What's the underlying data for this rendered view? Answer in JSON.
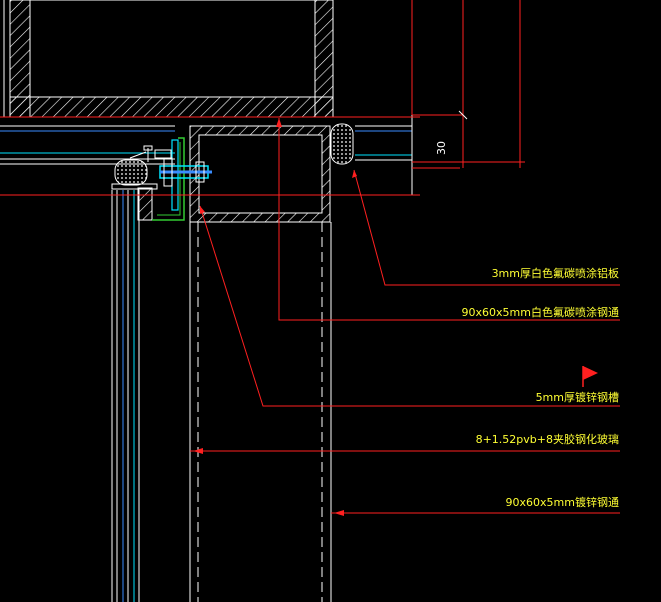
{
  "drawing": {
    "background": "#000000",
    "colors": {
      "structure": "#ffffff",
      "hatch": "#ffffff",
      "leader": "#ff2020",
      "label": "#ffff33",
      "glass": "#3a8dff",
      "cyan": "#00e5ff",
      "green": "#33cc33",
      "flag": "#ff2020"
    },
    "dimension": {
      "value": "30"
    },
    "callouts": [
      {
        "id": "aluminum-panel",
        "text": "3mm厚白色氟碳喷涂铝板"
      },
      {
        "id": "steel-tube-white",
        "text": "90x60x5mm白色氟碳喷涂钢通"
      },
      {
        "id": "steel-channel",
        "text": "5mm厚镀锌钢槽"
      },
      {
        "id": "laminated-glass",
        "text": "8+1.52pvb+8夹胶钢化玻璃"
      },
      {
        "id": "steel-tube-galv",
        "text": "90x60x5mm镀锌钢通"
      }
    ],
    "flag_icon": "red-flag-icon"
  }
}
